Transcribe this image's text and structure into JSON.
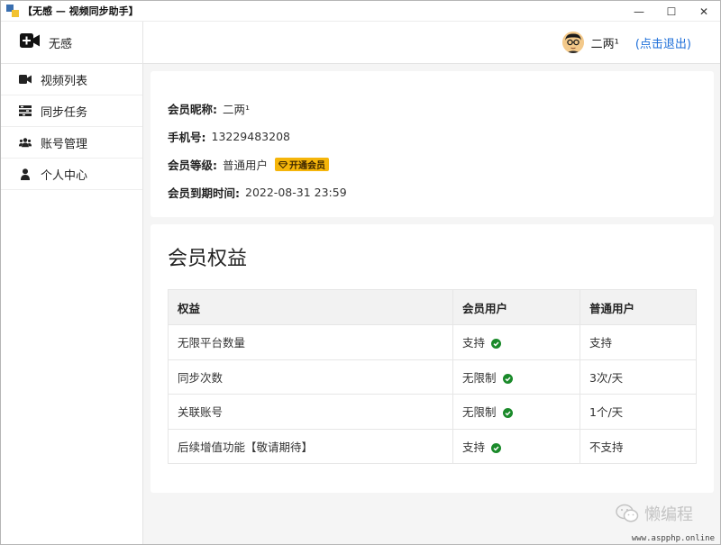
{
  "window": {
    "title": "【无感 — 视频同步助手】",
    "minimize": "—",
    "maximize": "☐",
    "close": "✕"
  },
  "sidebar": {
    "brand": "无感",
    "items": [
      {
        "label": "视频列表",
        "icon": "video-camera-icon"
      },
      {
        "label": "同步任务",
        "icon": "tasks-icon"
      },
      {
        "label": "账号管理",
        "icon": "users-icon"
      },
      {
        "label": "个人中心",
        "icon": "user-icon"
      }
    ]
  },
  "header": {
    "user_name": "二两¹",
    "logout": "(点击退出)"
  },
  "profile": {
    "nickname_label": "会员昵称:",
    "nickname": "二两¹",
    "phone_label": "手机号:",
    "phone": "13229483208",
    "level_label": "会员等级:",
    "level": "普通用户",
    "upgrade": "开通会员",
    "expire_label": "会员到期时间:",
    "expire": "2022-08-31 23:59"
  },
  "benefits": {
    "title": "会员权益",
    "columns": [
      "权益",
      "会员用户",
      "普通用户"
    ],
    "rows": [
      {
        "name": "无限平台数量",
        "vip": "支持",
        "normal": "支持"
      },
      {
        "name": "同步次数",
        "vip": "无限制",
        "normal": "3次/天"
      },
      {
        "name": "关联账号",
        "vip": "无限制",
        "normal": "1个/天"
      },
      {
        "name": "后续增值功能【敬请期待】",
        "vip": "支持",
        "normal": "不支持"
      }
    ]
  },
  "watermark": "懒编程",
  "site": "www.aspphp.online",
  "colors": {
    "link": "#1e6fd9",
    "ok": "#1a8a2a",
    "badge": "#f5b50a"
  }
}
